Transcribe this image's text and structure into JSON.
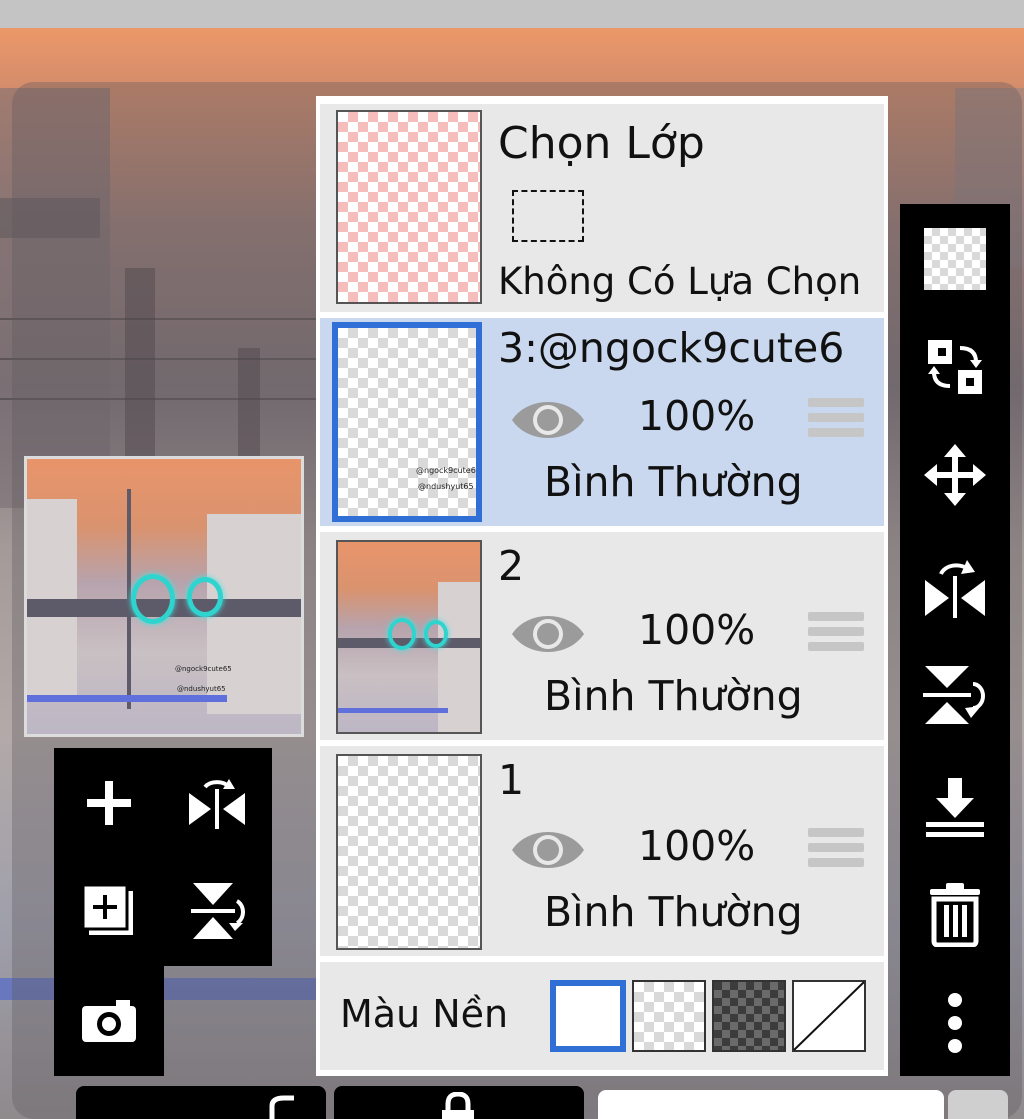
{
  "layer_panel": {
    "selection_layer": {
      "title": "Chọn Lớp",
      "status": "Không Có Lựa Chọn"
    },
    "layers": [
      {
        "name": "3:@ngock9cute6",
        "opacity": "100%",
        "blend_mode": "Bình Thường",
        "visible": true,
        "selected": true,
        "thumb_text": [
          "@ngock9cute65",
          "@ndushyut65"
        ]
      },
      {
        "name": "2",
        "opacity": "100%",
        "blend_mode": "Bình Thường",
        "visible": true,
        "selected": false
      },
      {
        "name": "1",
        "opacity": "100%",
        "blend_mode": "Bình Thường",
        "visible": true,
        "selected": false
      }
    ],
    "background_color": {
      "label": "Màu Nền",
      "options": [
        "white",
        "transparent",
        "dark-checker",
        "none"
      ],
      "selected": "white"
    }
  },
  "preview": {
    "signature_lines": [
      "@ngock9cute65",
      "@ndushyut65"
    ]
  },
  "colors": {
    "accent": "#2f6fd6",
    "selected_row": "#c9d8ee",
    "toolbar_bg": "#000000",
    "row_bg": "#e8e8e8"
  },
  "left_toolbar": [
    "add-layer-icon",
    "flip-horizontal-icon",
    "duplicate-layer-icon",
    "flip-vertical-icon",
    "camera-icon"
  ],
  "right_toolbar": [
    "transparency-icon",
    "swap-layers-icon",
    "move-icon",
    "flip-horizontal-rotate-icon",
    "flip-vertical-rotate-icon",
    "merge-down-icon",
    "delete-icon",
    "more-icon"
  ]
}
